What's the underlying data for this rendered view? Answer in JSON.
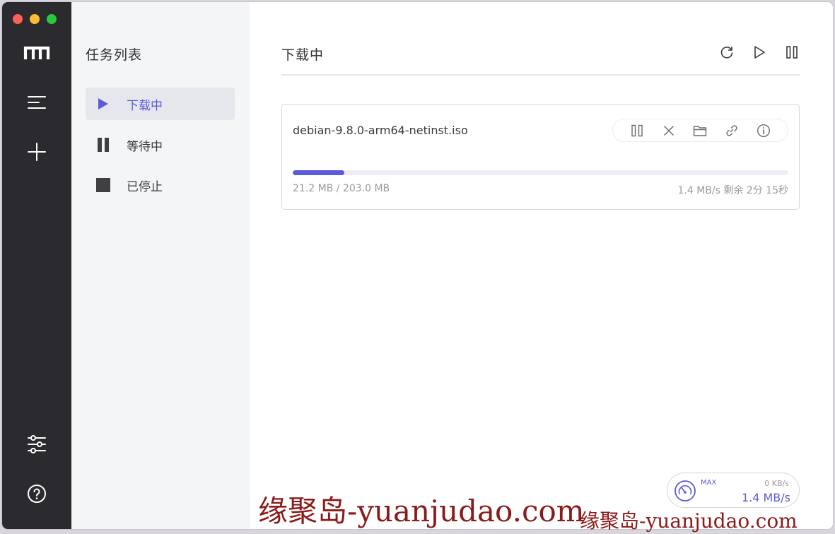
{
  "colors": {
    "sidebar_bg": "#2b2a2f",
    "accent": "#5b5bd6",
    "traffic_close": "#fe5f57",
    "traffic_min": "#febc2e",
    "traffic_max": "#28c840"
  },
  "sidebar": {
    "logo_icon": "motrix-m-icon",
    "buttons": [
      {
        "name": "task-list-button",
        "icon": "menu-lines-icon"
      },
      {
        "name": "add-task-button",
        "icon": "plus-icon"
      },
      {
        "name": "preferences-button",
        "icon": "sliders-icon"
      },
      {
        "name": "help-button",
        "icon": "question-circle-icon"
      }
    ]
  },
  "tasklist": {
    "title": "任务列表",
    "items": [
      {
        "label": "下载中",
        "icon": "play-icon",
        "active": true
      },
      {
        "label": "等待中",
        "icon": "pause-icon",
        "active": false
      },
      {
        "label": "已停止",
        "icon": "stop-icon",
        "active": false
      }
    ]
  },
  "main": {
    "title": "下载中",
    "header_actions": [
      "refresh-icon",
      "play-outline-icon",
      "pause-outline-icon"
    ]
  },
  "task": {
    "name": "debian-9.8.0-arm64-netinst.iso",
    "size_text": "21.2 MB / 203.0 MB",
    "speed_text": "1.4 MB/s 剩余 2分 15秒",
    "progress_fraction": 0.104,
    "actions": [
      "pause-outline-icon",
      "close-icon",
      "folder-icon",
      "link-icon",
      "info-icon"
    ]
  },
  "speedometer": {
    "max_label": "MAX",
    "upload": "0 KB/s",
    "download": "1.4 MB/s"
  },
  "watermark": {
    "main": "缘聚岛-yuanjudao.com",
    "small": "缘聚岛-yuanjudao.com"
  }
}
